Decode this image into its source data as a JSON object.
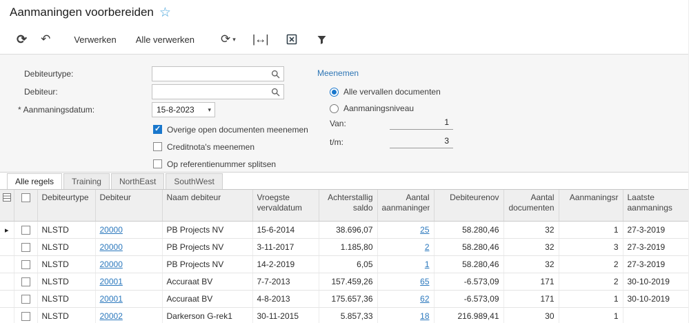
{
  "page": {
    "title": "Aanmaningen voorbereiden"
  },
  "toolbar": {
    "verwerken_label": "Verwerken",
    "alle_verwerken_label": "Alle verwerken"
  },
  "filters": {
    "debiteurtype": {
      "label": "Debiteurtype:",
      "value": ""
    },
    "debiteur": {
      "label": "Debiteur:",
      "value": ""
    },
    "aanmaningsdatum": {
      "label": "Aanmaningsdatum:",
      "required_marker": "*",
      "value": "15-8-2023"
    },
    "checkboxes": [
      {
        "label": "Overige open documenten meenemen",
        "checked": true
      },
      {
        "label": "Creditnota's meenemen",
        "checked": false
      },
      {
        "label": "Op referentienummer splitsen",
        "checked": false
      }
    ],
    "meenemen": {
      "label": "Meenemen",
      "options": [
        {
          "label": "Alle vervallen documenten",
          "selected": true
        },
        {
          "label": "Aanmaningsniveau",
          "selected": false
        }
      ],
      "van": {
        "label": "Van:",
        "value": "1"
      },
      "tm": {
        "label": "t/m:",
        "value": "3"
      }
    }
  },
  "tabs": [
    {
      "label": "Alle regels",
      "active": true
    },
    {
      "label": "Training",
      "active": false
    },
    {
      "label": "NorthEast",
      "active": false
    },
    {
      "label": "SouthWest",
      "active": false
    }
  ],
  "grid": {
    "columns": [
      {
        "key": "debiteurtype",
        "label": "Debiteurtype",
        "align": "left"
      },
      {
        "key": "debiteur",
        "label": "Debiteur",
        "align": "left",
        "link": true
      },
      {
        "key": "naam-debiteur",
        "label": "Naam debiteur",
        "align": "left"
      },
      {
        "key": "vroegste-vervaldatum",
        "label": "Vroegste vervaldatum",
        "align": "left"
      },
      {
        "key": "achterstallig-saldo",
        "label": "Achterstallig saldo",
        "align": "right"
      },
      {
        "key": "aantal-aanmaningen",
        "label": "Aantal aanmaningen",
        "align": "right",
        "link": true
      },
      {
        "key": "debiteurenoverzicht",
        "label": "Debiteurenov",
        "align": "right"
      },
      {
        "key": "aantal-documenten",
        "label": "Aantal documenten",
        "align": "right"
      },
      {
        "key": "aanmaningsniveau",
        "label": "Aanmaningsr",
        "align": "right"
      },
      {
        "key": "laatste-aanmaning",
        "label": "Laatste aanmanings",
        "align": "left"
      }
    ],
    "rows": [
      {
        "current": true,
        "checked": false,
        "cells": [
          "NLSTD",
          "20000",
          "PB Projects NV",
          "15-6-2014",
          "38.696,07",
          "25",
          "58.280,46",
          "32",
          "1",
          "27-3-2019"
        ]
      },
      {
        "current": false,
        "checked": false,
        "cells": [
          "NLSTD",
          "20000",
          "PB Projects NV",
          "3-11-2017",
          "1.185,80",
          "2",
          "58.280,46",
          "32",
          "3",
          "27-3-2019"
        ]
      },
      {
        "current": false,
        "checked": false,
        "cells": [
          "NLSTD",
          "20000",
          "PB Projects NV",
          "14-2-2019",
          "6,05",
          "1",
          "58.280,46",
          "32",
          "2",
          "27-3-2019"
        ]
      },
      {
        "current": false,
        "checked": false,
        "cells": [
          "NLSTD",
          "20001",
          "Accuraat BV",
          "7-7-2013",
          "157.459,26",
          "65",
          "-6.573,09",
          "171",
          "2",
          "30-10-2019"
        ]
      },
      {
        "current": false,
        "checked": false,
        "cells": [
          "NLSTD",
          "20001",
          "Accuraat BV",
          "4-8-2013",
          "175.657,36",
          "62",
          "-6.573,09",
          "171",
          "1",
          "30-10-2019"
        ]
      },
      {
        "current": false,
        "checked": false,
        "cells": [
          "NLSTD",
          "20002",
          "Darkerson G-rek1",
          "30-11-2015",
          "5.857,33",
          "18",
          "216.989,41",
          "30",
          "1",
          ""
        ]
      }
    ]
  },
  "colors": {
    "accent_blue": "#1977cc",
    "link_blue": "#2b78bd"
  }
}
